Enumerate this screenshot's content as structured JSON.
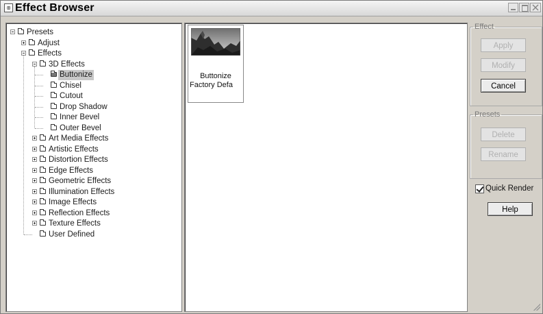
{
  "window": {
    "title": "Effect Browser",
    "system_icon": "⊞"
  },
  "tree": [
    {
      "label": "Presets",
      "level": 0,
      "expander": "minus",
      "open": false
    },
    {
      "label": "Adjust",
      "level": 1,
      "expander": "plus",
      "open": false
    },
    {
      "label": "Effects",
      "level": 1,
      "expander": "minus",
      "open": false
    },
    {
      "label": "3D Effects",
      "level": 2,
      "expander": "minus",
      "open": false
    },
    {
      "label": "Buttonize",
      "level": 3,
      "expander": "none",
      "open": true,
      "selected": true
    },
    {
      "label": "Chisel",
      "level": 3,
      "expander": "none",
      "open": false
    },
    {
      "label": "Cutout",
      "level": 3,
      "expander": "none",
      "open": false
    },
    {
      "label": "Drop Shadow",
      "level": 3,
      "expander": "none",
      "open": false
    },
    {
      "label": "Inner Bevel",
      "level": 3,
      "expander": "none",
      "open": false
    },
    {
      "label": "Outer Bevel",
      "level": 3,
      "expander": "none",
      "open": false
    },
    {
      "label": "Art Media Effects",
      "level": 2,
      "expander": "plus",
      "open": false
    },
    {
      "label": "Artistic Effects",
      "level": 2,
      "expander": "plus",
      "open": false
    },
    {
      "label": "Distortion Effects",
      "level": 2,
      "expander": "plus",
      "open": false
    },
    {
      "label": "Edge Effects",
      "level": 2,
      "expander": "plus",
      "open": false
    },
    {
      "label": "Geometric Effects",
      "level": 2,
      "expander": "plus",
      "open": false
    },
    {
      "label": "Illumination Effects",
      "level": 2,
      "expander": "plus",
      "open": false
    },
    {
      "label": "Image Effects",
      "level": 2,
      "expander": "plus",
      "open": false
    },
    {
      "label": "Reflection Effects",
      "level": 2,
      "expander": "plus",
      "open": false
    },
    {
      "label": "Texture Effects",
      "level": 2,
      "expander": "plus",
      "open": false
    },
    {
      "label": "User Defined",
      "level": 2,
      "expander": "none",
      "open": false
    }
  ],
  "thumbnail": {
    "name": "Buttonize",
    "preset": "Factory Defa"
  },
  "effect_group": {
    "legend": "Effect",
    "apply": "Apply",
    "modify": "Modify",
    "cancel": "Cancel"
  },
  "presets_group": {
    "legend": "Presets",
    "delete": "Delete",
    "rename": "Rename"
  },
  "quick_render": {
    "label": "Quick Render",
    "checked": true
  },
  "help": "Help"
}
